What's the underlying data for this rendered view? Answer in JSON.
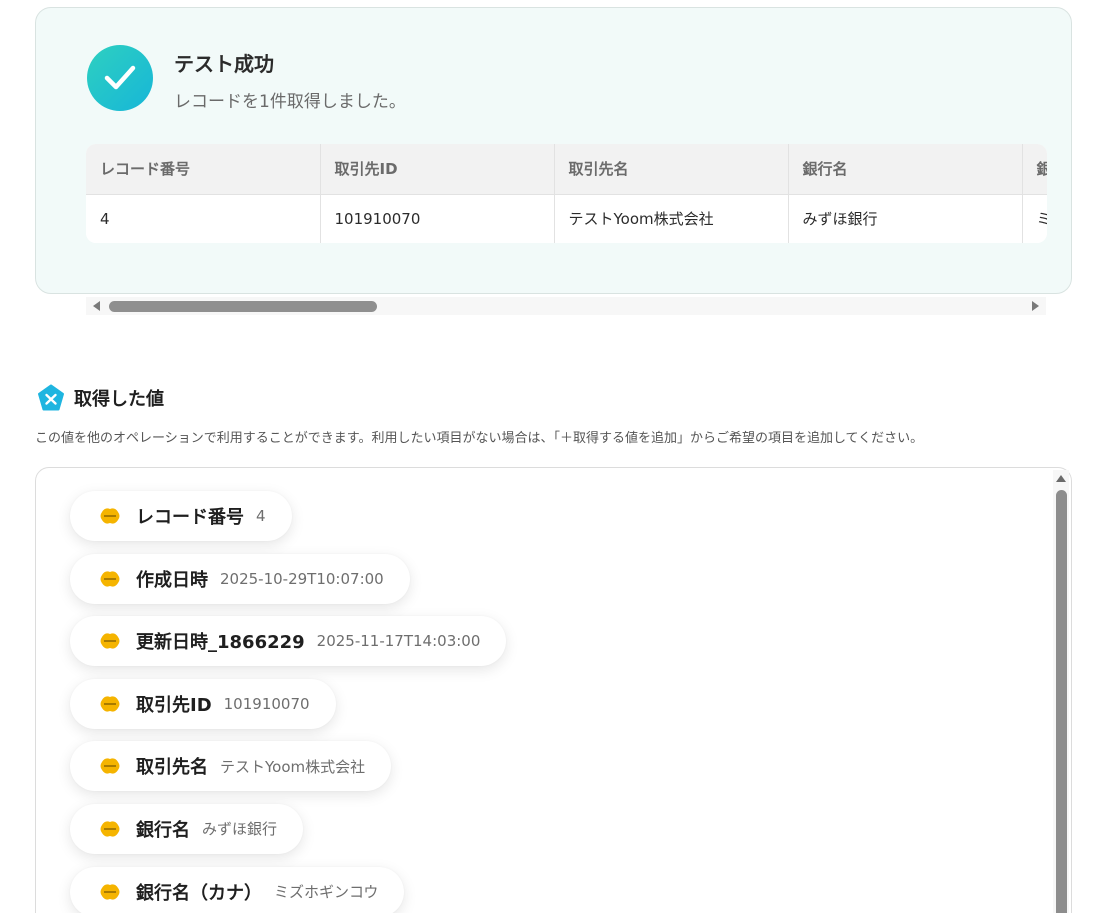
{
  "test_result": {
    "title": "テスト成功",
    "message": "レコードを1件取得しました。"
  },
  "record_table": {
    "columns": [
      "レコード番号",
      "取引先ID",
      "取引先名",
      "銀行名",
      "銀"
    ],
    "rows": [
      [
        "4",
        "101910070",
        "テストYoom株式会社",
        "みずほ銀行",
        "ミ"
      ]
    ]
  },
  "obtained_values": {
    "title": "取得した値",
    "description": "この値を他のオペレーションで利用することができます。利用したい項目がない場合は、「＋取得する値を追加」からご希望の項目を追加してください。",
    "items": [
      {
        "label": "レコード番号",
        "value": "4"
      },
      {
        "label": "作成日時",
        "value": "2025-10-29T10:07:00"
      },
      {
        "label": "更新日時_1866229",
        "value": "2025-11-17T14:03:00"
      },
      {
        "label": "取引先ID",
        "value": "101910070"
      },
      {
        "label": "取引先名",
        "value": "テストYoom株式会社"
      },
      {
        "label": "銀行名",
        "value": "みずほ銀行"
      },
      {
        "label": "銀行名（カナ）",
        "value": "ミズホギンコウ"
      }
    ]
  },
  "icons": {
    "success": "check-circle-icon",
    "values_section": "yoom-logo-icon",
    "item": "kintone-icon"
  },
  "colors": {
    "accent": "#1fc3c9",
    "card_background": "#f2faf9",
    "kintone": "#f5b400"
  }
}
